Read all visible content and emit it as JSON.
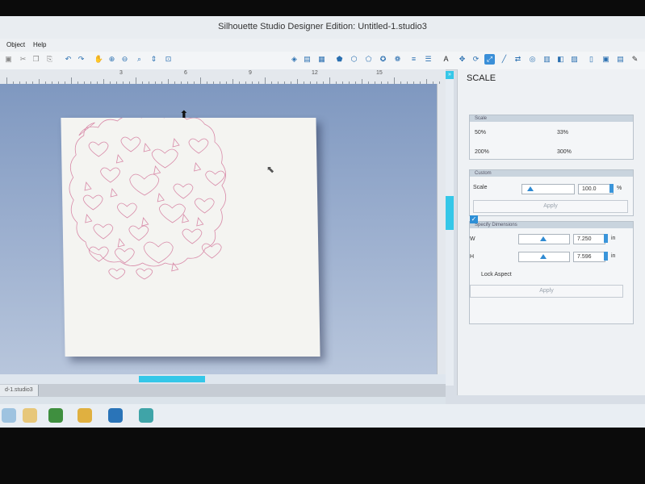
{
  "window": {
    "title": "Silhouette Studio Designer Edition: Untitled-1.studio3"
  },
  "menu": {
    "items": [
      "Object",
      "Help"
    ]
  },
  "ruler": {
    "labels": [
      "3",
      "6",
      "9",
      "12",
      "15"
    ]
  },
  "panel": {
    "title": "SCALE",
    "scale_section": {
      "header": "Scale",
      "presets": [
        "50%",
        "33%",
        "200%",
        "300%"
      ]
    },
    "custom_section": {
      "header": "Custom",
      "scale_label": "Scale",
      "scale_value": "100.0",
      "unit": "%",
      "apply_label": "Apply"
    },
    "dimensions_section": {
      "header": "Specify Dimensions",
      "w_label": "W",
      "w_value": "7.250",
      "w_unit": "in",
      "h_label": "H",
      "h_value": "7.596",
      "h_unit": "in",
      "lock_aspect_label": "Lock Aspect",
      "lock_aspect_checked": true,
      "apply_label": "Apply"
    }
  },
  "document": {
    "tab_label": "d-1.studio3"
  },
  "colors": {
    "accent": "#35c7e8",
    "design_line": "#d88aa8",
    "mat": "#f4f4f1"
  }
}
